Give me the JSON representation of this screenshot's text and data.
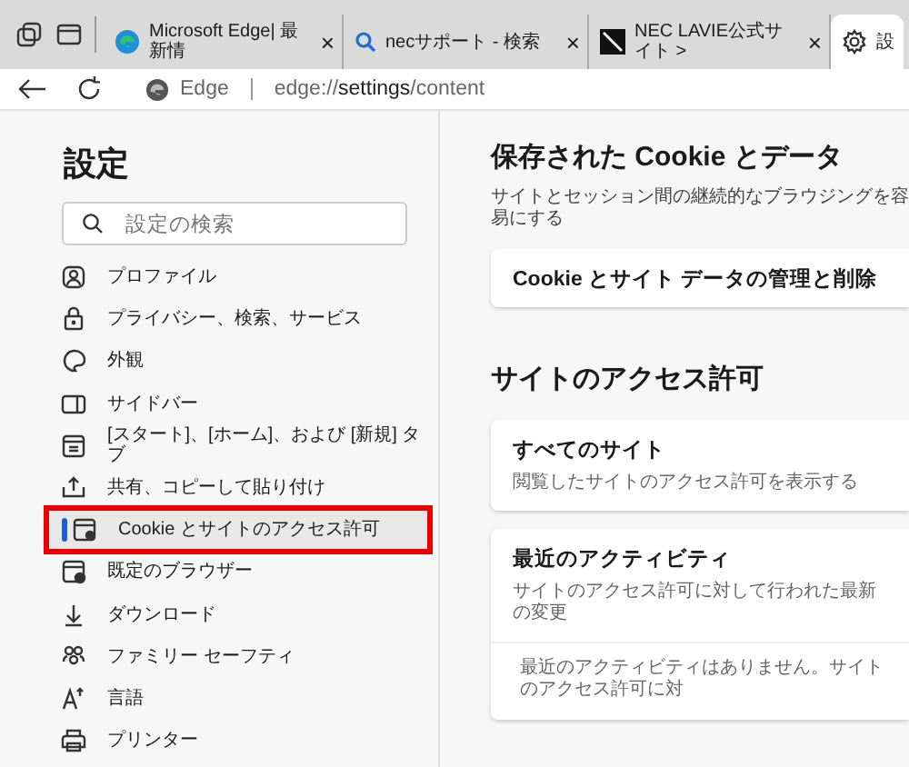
{
  "browser": {
    "tabs": [
      {
        "title": "Microsoft Edge| 最新情",
        "kind": "edge",
        "selected": false,
        "close": "×"
      },
      {
        "title": "necサポート - 検索",
        "kind": "search",
        "selected": false,
        "close": "×"
      },
      {
        "title": "NEC LAVIE公式サイト >",
        "kind": "nec",
        "selected": false,
        "close": "×"
      },
      {
        "title": "設",
        "kind": "settings",
        "selected": true
      }
    ],
    "address": {
      "site": "Edge",
      "url": "edge://**settings**/content"
    }
  },
  "sidebar": {
    "title": "設定",
    "search": {
      "placeholder": "設定の検索"
    },
    "items": [
      {
        "label": "プロファイル",
        "selected": false,
        "highlighted": false
      },
      {
        "label": "プライバシー、検索、サービス",
        "selected": false,
        "highlighted": false
      },
      {
        "label": "外観",
        "selected": false,
        "highlighted": false
      },
      {
        "label": "サイドバー",
        "selected": false,
        "highlighted": false
      },
      {
        "label": "[スタート]、[ホーム]、および [新規] タブ",
        "selected": false,
        "highlighted": false
      },
      {
        "label": "共有、コピーして貼り付け",
        "selected": false,
        "highlighted": false
      },
      {
        "label": "Cookie とサイトのアクセス許可",
        "selected": true,
        "highlighted": true
      },
      {
        "label": "既定のブラウザー",
        "selected": false,
        "highlighted": false
      },
      {
        "label": "ダウンロード",
        "selected": false,
        "highlighted": false
      },
      {
        "label": "ファミリー セーフティ",
        "selected": false,
        "highlighted": false
      },
      {
        "label": "言語",
        "selected": false,
        "highlighted": false
      },
      {
        "label": "プリンター",
        "selected": false,
        "highlighted": false
      }
    ]
  },
  "content": {
    "sections": [
      {
        "title": "保存された Cookie とデータ",
        "description": "サイトとセッション間の継続的なブラウジングを容易にする",
        "cards": [
          {
            "title": "Cookie とサイト データの管理と削除"
          }
        ]
      },
      {
        "title": "サイトのアクセス許可",
        "cards": [
          {
            "title": "すべてのサイト",
            "subtitle": "閲覧したサイトのアクセス許可を表示する"
          },
          {
            "title": "最近のアクティビティ",
            "subtitle": "サイトのアクセス許可に対して行われた最新の変更",
            "detail": "最近のアクティビティはありません。サイトのアクセス許可に対"
          }
        ]
      }
    ]
  }
}
